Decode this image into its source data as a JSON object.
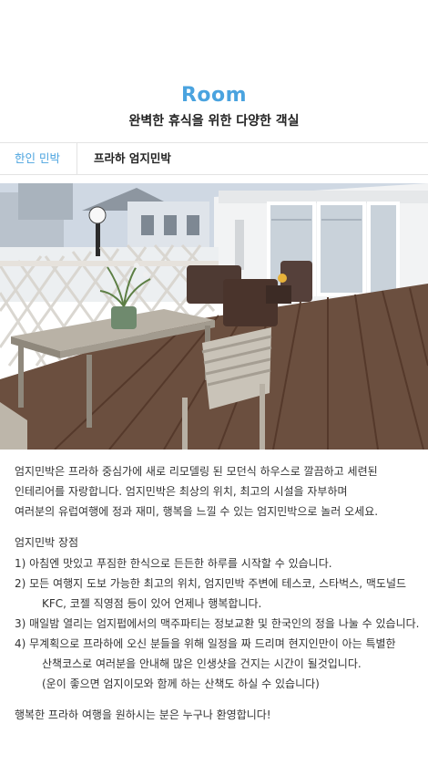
{
  "header": {
    "title": "Room",
    "subtitle": "완벽한 휴식을 위한 다양한 객실"
  },
  "tabs": [
    {
      "label": "한인 민박",
      "active": true
    },
    {
      "label": "프라하 엄지민박",
      "active": false
    }
  ],
  "colors": {
    "accent": "#4aa3df",
    "text": "#333333",
    "border": "#e3e3e3"
  },
  "intro": {
    "line1": "엄지민박은 프라하 중심가에 새로 리모델링 된 모던식 하우스로 깔끔하고 세련된",
    "line2": "인테리어를 자랑합니다. 엄지민박은 최상의 위치, 최고의 시설을 자부하며",
    "line3": "여러분의 유럽여행에 정과 재미, 행복을 느낄 수 있는 엄지민박으로 놀러 오세요."
  },
  "features": {
    "title": "엄지민박 장점",
    "item1": "1) 아침엔 맛있고 푸짐한 한식으로 든든한 하루를 시작할 수 있습니다.",
    "item2a": "2) 모든 여행지 도보 가능한 최고의 위치, 엄지민박 주변에 테스코, 스타벅스, 맥도널드",
    "item2b": "KFC, 코젤 직영점 등이 있어 언제나 행복합니다.",
    "item3": "3) 매일밤 열리는 엄지펍에서의 맥주파티는 정보교환 및 한국인의 정을 나눌 수 있습니다.",
    "item4a": "4) 무계획으로 프라하에 오신 분들을 위해 일정을 짜 드리며 현지인만이 아는 특별한",
    "item4b": "산책코스로 여러분을 안내해 많은 인생샷을 건지는 시간이 될것입니다.",
    "item4c": "(운이 좋으면 엄지이모와 함께 하는 산책도 하실 수 있습니다)"
  },
  "closing": "행복한 프라하 여행을 원하시는 분은 누구나 환영합니다!"
}
